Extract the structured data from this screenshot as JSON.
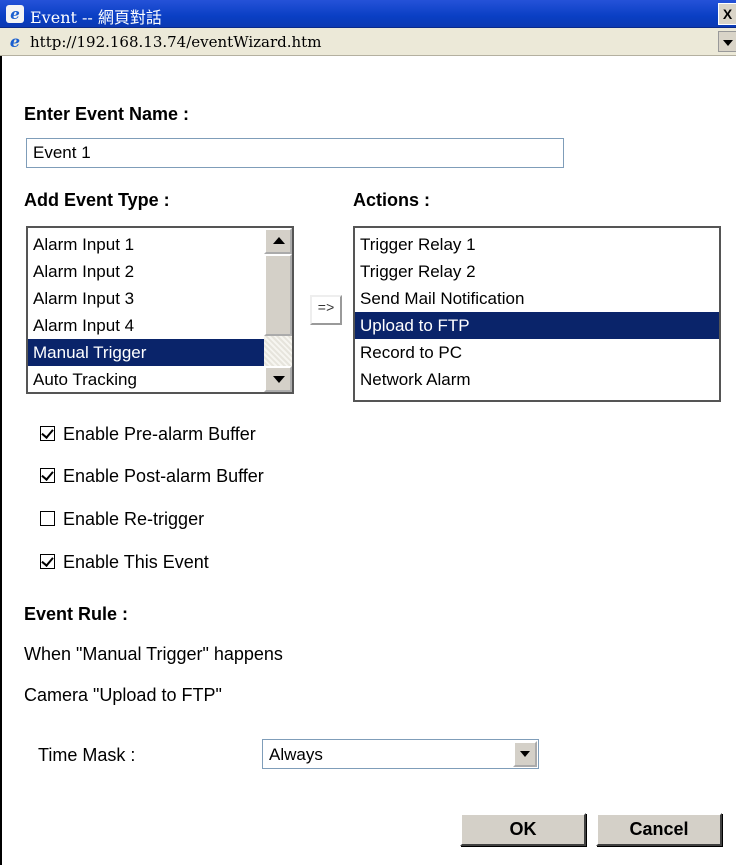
{
  "window": {
    "title": "Event -- 網頁對話",
    "close_label": "X",
    "app_icon": "ie-icon"
  },
  "address_bar": {
    "url": "http://192.168.13.74/eventWizard.htm"
  },
  "event_name": {
    "heading": "Enter Event Name :",
    "value": "Event 1"
  },
  "event_type": {
    "heading": "Add Event Type :",
    "items": [
      "Alarm Input 1",
      "Alarm Input 2",
      "Alarm Input 3",
      "Alarm Input 4",
      "Manual Trigger",
      "Auto Tracking"
    ],
    "selected": "Manual Trigger"
  },
  "transfer_button": {
    "label": "=>"
  },
  "actions": {
    "heading": "Actions :",
    "items": [
      "Trigger Relay 1",
      "Trigger Relay 2",
      "Send Mail Notification",
      "Upload to FTP",
      "Record to PC",
      "Network Alarm"
    ],
    "selected": "Upload to FTP"
  },
  "options": [
    {
      "label": "Enable Pre-alarm Buffer",
      "checked": true
    },
    {
      "label": "Enable Post-alarm Buffer",
      "checked": true
    },
    {
      "label": "Enable Re-trigger",
      "checked": false
    },
    {
      "label": "Enable This Event",
      "checked": true
    }
  ],
  "event_rule": {
    "heading": "Event Rule :",
    "line1": "When \"Manual Trigger\" happens",
    "line2": "Camera \"Upload to FTP\""
  },
  "time_mask": {
    "label": "Time Mask :",
    "value": "Always"
  },
  "buttons": {
    "ok": "OK",
    "cancel": "Cancel"
  },
  "colors": {
    "titlebar": "#0a3fc4",
    "selection": "#0a246a"
  }
}
